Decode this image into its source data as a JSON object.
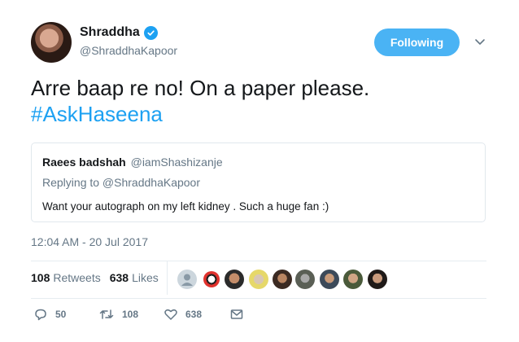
{
  "user": {
    "name": "Shraddha",
    "handle": "@ShraddhaKapoor",
    "follow_label": "Following"
  },
  "tweet": {
    "text": "Arre baap re no! On a paper please.",
    "hashtag": "#AskHaseena",
    "timestamp": "12:04 AM - 20 Jul 2017"
  },
  "quote": {
    "author_name": "Raees badshah",
    "author_handle": "@iamShashizanje",
    "replying_to": "Replying to @ShraddhaKapoor",
    "text": "Want your autograph on my left kidney . Such a huge fan :)"
  },
  "stats": {
    "retweets": "108",
    "retweets_label": "Retweets",
    "likes": "638",
    "likes_label": "Likes"
  },
  "actions": {
    "reply_count": "50",
    "retweet_count": "108",
    "like_count": "638"
  },
  "colors": {
    "accent": "#1da1f2",
    "muted": "#657786",
    "border": "#e1e8ed"
  }
}
